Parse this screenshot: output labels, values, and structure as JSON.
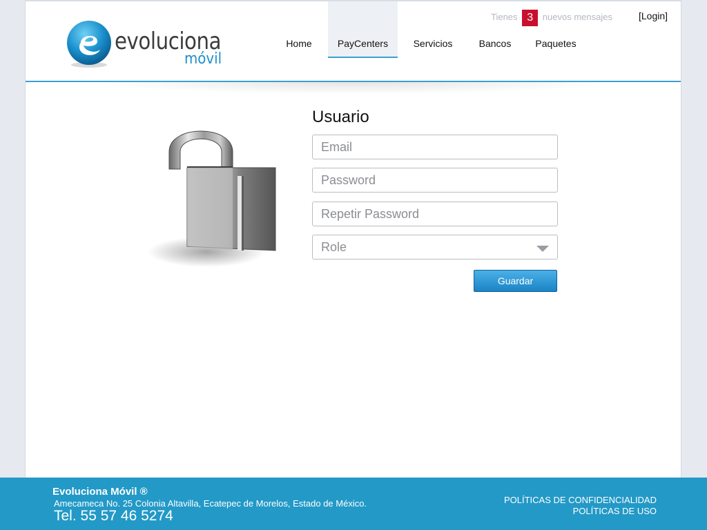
{
  "header": {
    "logo": {
      "word": "evoluciona",
      "sub": "móvil"
    },
    "nav": [
      {
        "label": "Home"
      },
      {
        "label": "PayCenters"
      },
      {
        "label": "Servicios"
      },
      {
        "label": "Bancos"
      },
      {
        "label": "Paquetes"
      }
    ],
    "active_nav": "PayCenters",
    "messages": {
      "prefix": "Tienes",
      "count": "3",
      "suffix": "nuevos mensajes"
    },
    "login_label": "[Login]"
  },
  "form": {
    "title": "Usuario",
    "email_placeholder": "Email",
    "password_placeholder": "Password",
    "repeat_password_placeholder": "Repetir Password",
    "role_placeholder": "Role",
    "submit_label": "Guardar"
  },
  "footer": {
    "company": "Evoluciona Móvil ®",
    "address": "Amecameca No. 25 Colonia Altavilla, Ecatepec de Morelos, Estado de México.",
    "tel": "Tel. 55 57 46 5274",
    "links": [
      {
        "label": "POLÍTICAS DE CONFIDENCIALIDAD"
      },
      {
        "label": "POLÍTICAS DE USO"
      }
    ]
  },
  "colors": {
    "accent": "#1f8fc9",
    "badge": "#c8102e",
    "footer_bg": "#2399c7"
  },
  "icons": [
    "evoluciona-logo-icon",
    "padlock-icon",
    "chevron-down-icon"
  ]
}
